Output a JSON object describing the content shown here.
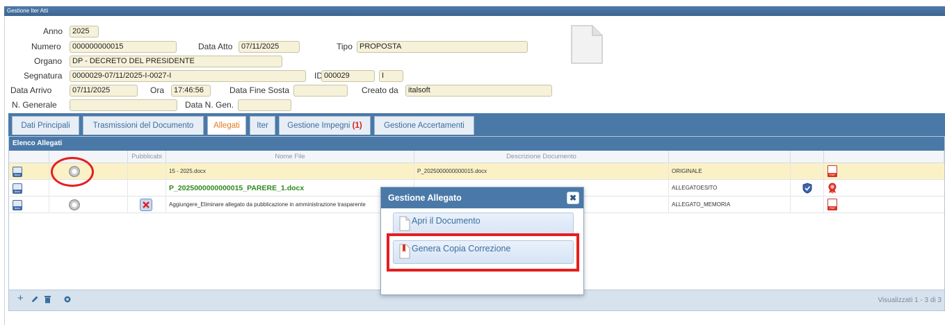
{
  "window": {
    "title": "Gestione Iter Atti"
  },
  "form": {
    "anno_label": "Anno",
    "anno": "2025",
    "numero_label": "Numero",
    "numero": "000000000015",
    "data_atto_label": "Data Atto",
    "data_atto": "07/11/2025",
    "tipo_label": "Tipo",
    "tipo": "PROPOSTA",
    "organo_label": "Organo",
    "organo": "DP - DECRETO DEL PRESIDENTE",
    "segnatura_label": "Segnatura",
    "segnatura": "0000029-07/11/2025-I-0027-I",
    "id_label": "ID",
    "id": "000029",
    "id_suffix": "I",
    "data_arrivo_label": "Data Arrivo",
    "data_arrivo": "07/11/2025",
    "ora_label": "Ora",
    "ora": "17:46:56",
    "data_fine_sosta_label": "Data Fine Sosta",
    "data_fine_sosta": "",
    "creato_da_label": "Creato da",
    "creato_da": "italsoft",
    "n_generale_label": "N. Generale",
    "n_generale": "",
    "data_n_gen_label": "Data N. Gen.",
    "data_n_gen": ""
  },
  "tabs": [
    {
      "label": "Dati Principali"
    },
    {
      "label": "Trasmissioni del Documento"
    },
    {
      "label": "Allegati"
    },
    {
      "label": "Iter"
    },
    {
      "label": "Gestione Impegni",
      "count": "(1)"
    },
    {
      "label": "Gestione Accertamenti"
    }
  ],
  "grid": {
    "title": "Elenco Allegati",
    "columns": {
      "pubblicabile": "Pubblicabi",
      "nome_file": "Nome File",
      "descrizione": "Descrizione Documento"
    },
    "rows": [
      {
        "nome": "15 - 2025.docx",
        "descrizione": "P_2025000000000015.docx",
        "tipo": "ORIGINALE"
      },
      {
        "nome": "P_2025000000000015_PARERE_1.docx",
        "descrizione": "",
        "tipo": "ALLEGATOESITO"
      },
      {
        "nome": "Aggiungere_Eliminare allegato da pubblicazione in amministrazione trasparente",
        "descrizione": "",
        "tipo": "ALLEGATO_MEMORIA"
      }
    ],
    "footer_status": "Visualizzati 1 - 3 di 3"
  },
  "dialog": {
    "title": "Gestione Allegato",
    "close": "✖",
    "apri": "Apri il Documento",
    "genera": "Genera Copia Correzione"
  },
  "icons": {
    "footer": [
      "add-icon",
      "edit-icon",
      "delete-icon",
      "settings-icon"
    ]
  },
  "colors": {
    "header_blue": "#4a79a8",
    "field_bg": "#f6f1d9",
    "highlight_red": "#e51e1e",
    "active_tab": "#e07b1f"
  }
}
